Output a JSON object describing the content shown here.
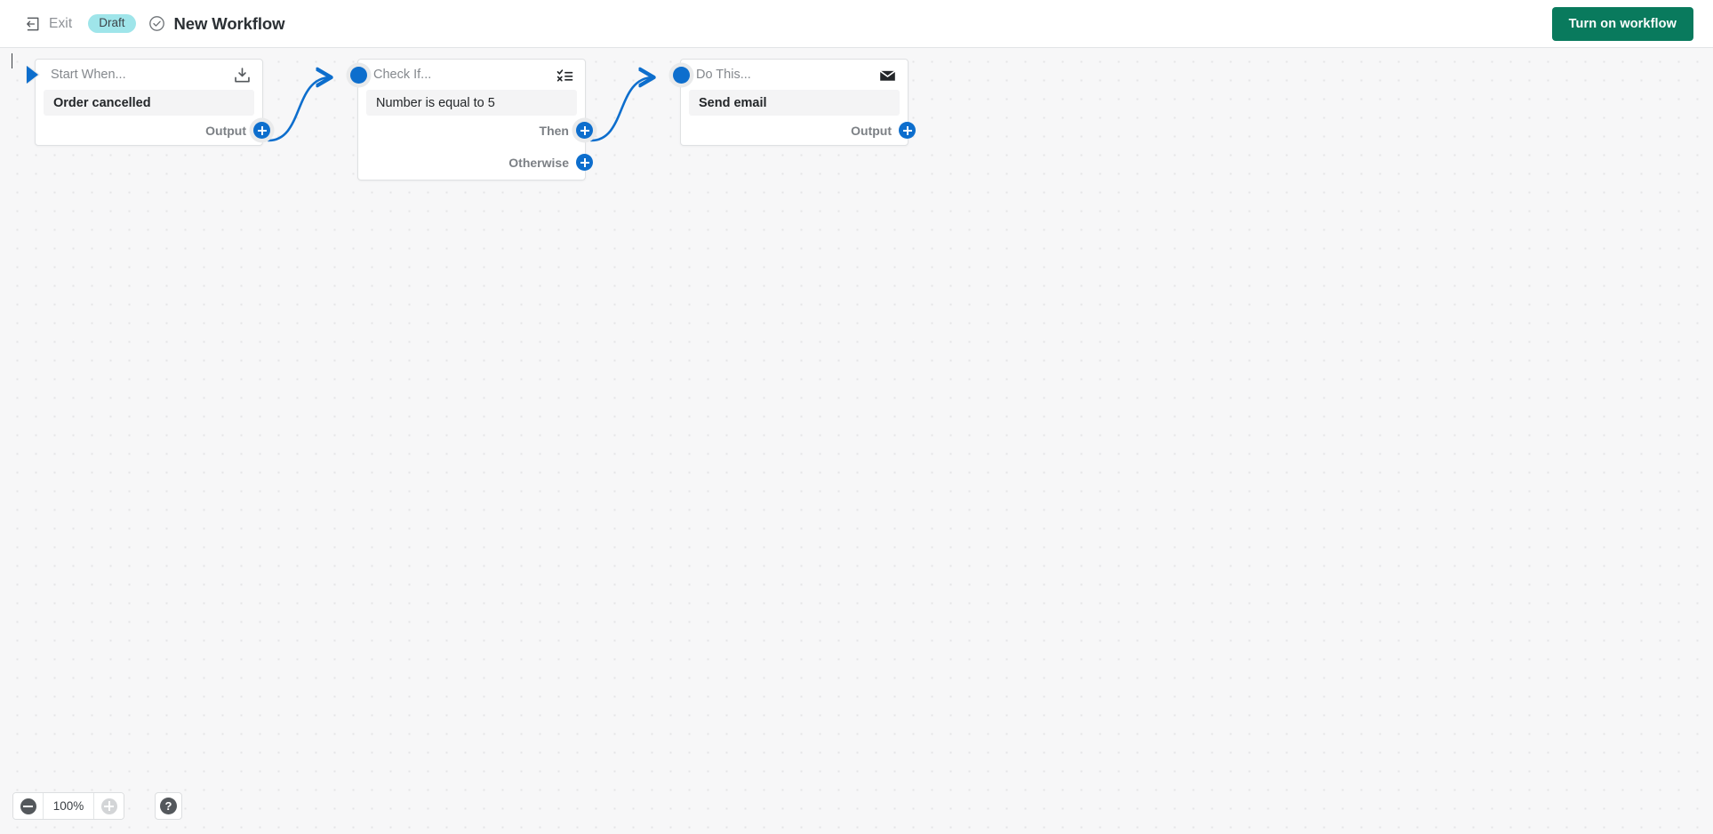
{
  "header": {
    "exit_label": "Exit",
    "exit_icon": "exit-arrow-icon",
    "status_badge": "Draft",
    "status_check_icon": "check-circle-icon",
    "title": "New Workflow",
    "primary_button": "Turn on workflow",
    "primary_button_color": "#097a5d",
    "badge_color": "#9fe5ea"
  },
  "canvas": {
    "background_color": "#f7f7f8",
    "dot_color": "#e4e4e6",
    "accent_color": "#0d6ecd",
    "nodes": [
      {
        "id": "trigger",
        "title": "Start When...",
        "icon": "inbox-download-icon",
        "body": "Order cancelled",
        "ports": [
          {
            "label": "Output",
            "connected": true
          }
        ]
      },
      {
        "id": "condition",
        "title": "Check If...",
        "icon": "check-cross-list-icon",
        "body": "Number is equal to 5",
        "ports": [
          {
            "label": "Then",
            "connected": true
          },
          {
            "label": "Otherwise",
            "connected": false
          }
        ]
      },
      {
        "id": "action",
        "title": "Do This...",
        "icon": "envelope-icon",
        "body": "Send email",
        "ports": [
          {
            "label": "Output",
            "connected": false
          }
        ]
      }
    ]
  },
  "footer": {
    "zoom_out_icon": "minus-circle-icon",
    "zoom_level": "100%",
    "zoom_in_icon": "plus-circle-icon",
    "help_label": "?"
  }
}
